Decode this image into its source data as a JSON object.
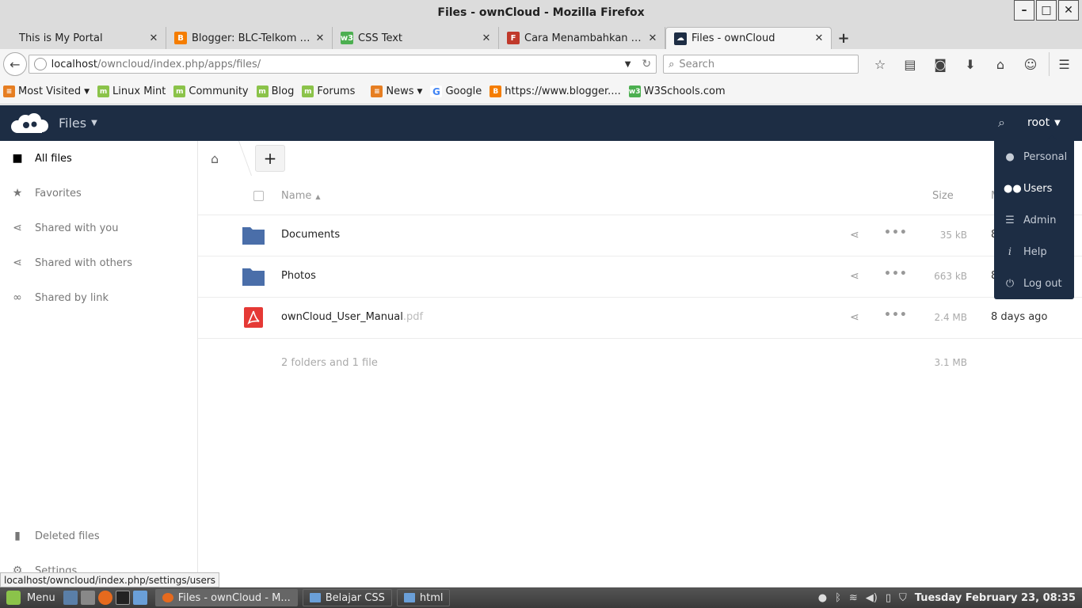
{
  "window": {
    "title": "Files - ownCloud - Mozilla Firefox"
  },
  "tabs": [
    {
      "label": "This is My Portal",
      "icon": "blank",
      "color": ""
    },
    {
      "label": "Blogger: BLC-Telkom Klat…",
      "icon": "blogger-icon",
      "color": "#f57d00"
    },
    {
      "label": "CSS Text",
      "icon": "w3schools-icon",
      "color": "#4caf50"
    },
    {
      "label": "Cara Menambahkan Use…",
      "icon": "site-icon",
      "color": "#c0392b"
    },
    {
      "label": "Files - ownCloud",
      "icon": "owncloud-icon",
      "color": "#1d2d44"
    }
  ],
  "nav": {
    "url_host": "localhost",
    "url_path": "/owncloud/index.php/apps/files/",
    "search_placeholder": "Search"
  },
  "bookmarks": [
    {
      "label": "Most Visited",
      "icon": "rss-icon",
      "color": "#e67e22",
      "dropdown": true
    },
    {
      "label": "Linux Mint",
      "icon": "mint-icon",
      "color": "#8bc34a",
      "dropdown": false
    },
    {
      "label": "Community",
      "icon": "mint-icon",
      "color": "#8bc34a",
      "dropdown": false
    },
    {
      "label": "Blog",
      "icon": "mint-icon",
      "color": "#8bc34a",
      "dropdown": false
    },
    {
      "label": "Forums",
      "icon": "mint-icon",
      "color": "#8bc34a",
      "dropdown": false
    },
    {
      "label": "News",
      "icon": "rss-icon",
      "color": "#e67e22",
      "dropdown": true
    },
    {
      "label": "Google",
      "icon": "google-icon",
      "color": "#4285f4",
      "dropdown": false
    },
    {
      "label": "https://www.blogger....",
      "icon": "blogger-icon",
      "color": "#f57d00",
      "dropdown": false
    },
    {
      "label": "W3Schools.com",
      "icon": "w3schools-icon",
      "color": "#4caf50",
      "dropdown": false
    }
  ],
  "header": {
    "app_name": "Files",
    "user": "root",
    "brand_color": "#1d2d44"
  },
  "sidebar": {
    "items": [
      {
        "label": "All files",
        "icon": "folder-icon",
        "active": true
      },
      {
        "label": "Favorites",
        "icon": "star-icon",
        "active": false
      },
      {
        "label": "Shared with you",
        "icon": "share-icon",
        "active": false
      },
      {
        "label": "Shared with others",
        "icon": "share-icon",
        "active": false
      },
      {
        "label": "Shared by link",
        "icon": "link-icon",
        "active": false
      }
    ],
    "deleted": "Deleted files",
    "settings": "Settings"
  },
  "table": {
    "col_name": "Name",
    "col_size": "Size",
    "col_modified": "M",
    "rows": [
      {
        "name": "Documents",
        "ext": "",
        "type": "folder",
        "size": "35 kB",
        "modified": "8"
      },
      {
        "name": "Photos",
        "ext": "",
        "type": "folder",
        "size": "663 kB",
        "modified": "8"
      },
      {
        "name": "ownCloud_User_Manual",
        "ext": ".pdf",
        "type": "pdf",
        "size": "2.4 MB",
        "modified": "8 days ago"
      }
    ],
    "summary": "2 folders and 1 file",
    "summary_size": "3.1 MB"
  },
  "user_menu": [
    {
      "label": "Personal",
      "icon": "person-icon",
      "active": false
    },
    {
      "label": "Users",
      "icon": "users-icon",
      "active": true
    },
    {
      "label": "Admin",
      "icon": "admin-list-icon",
      "active": false
    },
    {
      "label": "Help",
      "icon": "info-icon",
      "active": false
    },
    {
      "label": "Log out",
      "icon": "power-icon",
      "active": false
    }
  ],
  "status_url": "localhost/owncloud/index.php/settings/users",
  "taskbar": {
    "menu": "Menu",
    "windows": [
      {
        "label": "Files - ownCloud - M...",
        "active": true
      },
      {
        "label": "Belajar CSS",
        "active": false
      },
      {
        "label": "html",
        "active": false
      }
    ],
    "clock": "Tuesday February 23, 08:35"
  }
}
